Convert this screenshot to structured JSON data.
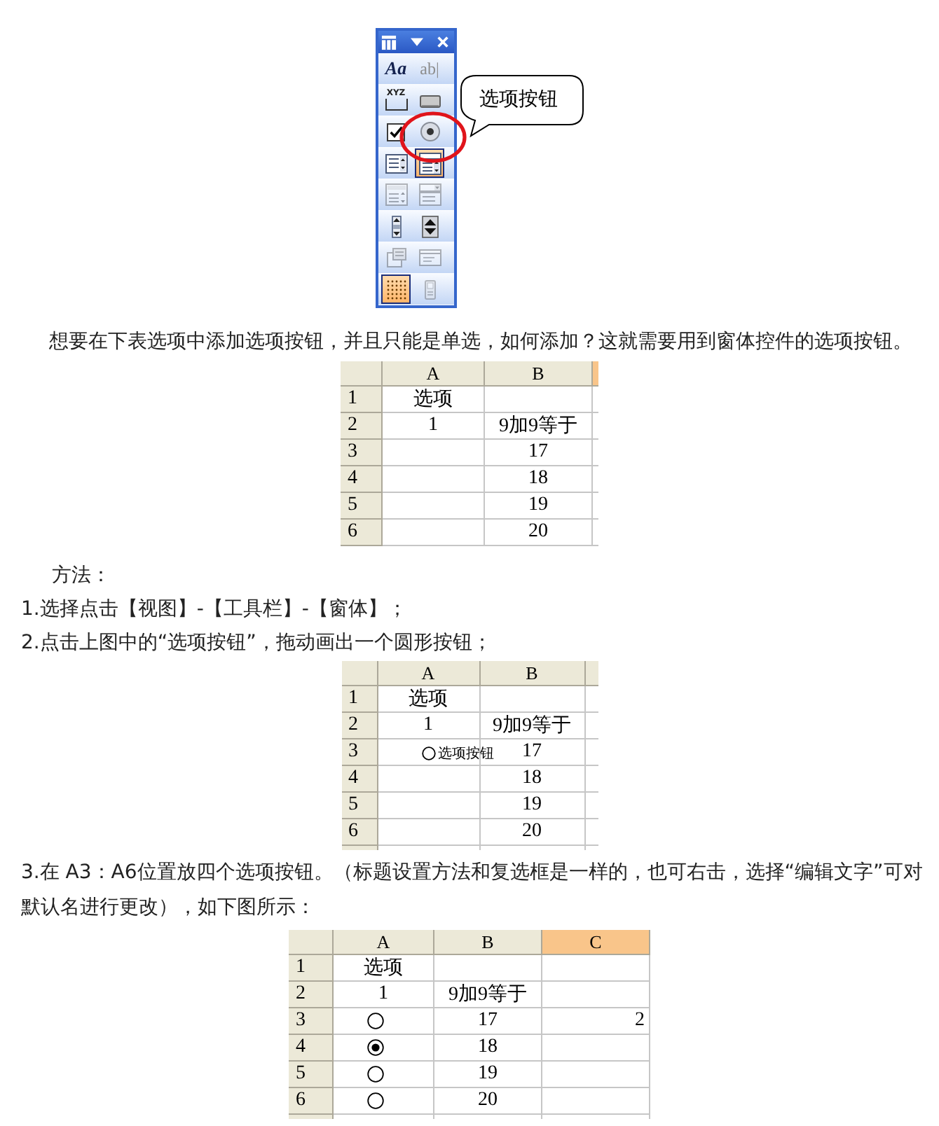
{
  "toolbar": {
    "buttons": [
      {
        "kind": "label",
        "text": "Aa",
        "selected": false,
        "disabled": false
      },
      {
        "kind": "edit_box",
        "text": "ab|",
        "selected": false,
        "disabled": true
      },
      {
        "kind": "group_box",
        "text": "XYZ",
        "selected": false,
        "disabled": false
      },
      {
        "kind": "button",
        "selected": false,
        "disabled": false
      },
      {
        "kind": "checkbox",
        "selected": false,
        "disabled": false
      },
      {
        "kind": "option_button",
        "selected": false,
        "disabled": false
      },
      {
        "kind": "list_box",
        "selected": false,
        "disabled": false
      },
      {
        "kind": "combo_box",
        "selected": true,
        "disabled": false
      },
      {
        "kind": "combo_list_edit",
        "selected": false,
        "disabled": true
      },
      {
        "kind": "combo_drop_edit",
        "selected": false,
        "disabled": true
      },
      {
        "kind": "scroll_bar",
        "selected": false,
        "disabled": false
      },
      {
        "kind": "spinner",
        "selected": false,
        "disabled": false
      },
      {
        "kind": "control_properties",
        "selected": false,
        "disabled": true
      },
      {
        "kind": "edit_code",
        "selected": false,
        "disabled": true
      },
      {
        "kind": "toggle_grid",
        "selected": true,
        "disabled": false
      },
      {
        "kind": "run_dialog",
        "selected": false,
        "disabled": true
      }
    ]
  },
  "callout": {
    "text": "选项按钮"
  },
  "intro": "想要在下表选项中添加选项按钮，并且只能是单选，如何添加？这就需要用到窗体控件的选项按钮。",
  "table_1": {
    "columns": [
      {
        "label": "A",
        "selected": false
      },
      {
        "label": "B",
        "selected": false
      }
    ],
    "cut_column": {
      "selected": true
    },
    "rows": [
      {
        "header": "1",
        "a": "选项"
      },
      {
        "header": "2",
        "a": "1",
        "b": "9加9等于"
      },
      {
        "header": "3",
        "b": "17"
      },
      {
        "header": "4",
        "b": "18"
      },
      {
        "header": "5",
        "b": "19"
      },
      {
        "header": "6",
        "b": "20"
      }
    ]
  },
  "method_heading": "方法：",
  "steps": [
    "1.选择点击【视图】-【工具栏】-【窗体】；",
    "2.点击上图中的“选项按钮”，拖动画出一个圆形按钮；"
  ],
  "table_2": {
    "columns": [
      {
        "label": "A",
        "selected": false
      },
      {
        "label": "B",
        "selected": false
      }
    ],
    "cut_column": {
      "selected": false
    },
    "cut_row": true,
    "rows": [
      {
        "header": "1",
        "a": "选项"
      },
      {
        "header": "2",
        "a": "1",
        "b": "9加9等于"
      },
      {
        "header": "3",
        "b": "17",
        "option_button": {
          "label": "选项按钮",
          "selected": false
        }
      },
      {
        "header": "4",
        "b": "18"
      },
      {
        "header": "5",
        "b": "19"
      },
      {
        "header": "6",
        "b": "20"
      }
    ]
  },
  "step_3": "3.在 A3：A6位置放四个选项按钮。（标题设置方法和复选框是一样的，也可右击，选择“编辑文字”可对默认名进行更改），如下图所示：",
  "table_3": {
    "columns": [
      {
        "label": "A",
        "selected": false
      },
      {
        "label": "B",
        "selected": false
      },
      {
        "label": "C",
        "selected": true
      }
    ],
    "cut_row": true,
    "rows": [
      {
        "header": "1",
        "a": "选项"
      },
      {
        "header": "2",
        "a": "1",
        "b": "9加9等于"
      },
      {
        "header": "3",
        "b": "17",
        "c": "2",
        "option_button": {
          "selected": false
        }
      },
      {
        "header": "4",
        "b": "18",
        "option_button": {
          "selected": true
        }
      },
      {
        "header": "5",
        "b": "19",
        "option_button": {
          "selected": false
        }
      },
      {
        "header": "6",
        "b": "20",
        "option_button": {
          "selected": false
        }
      }
    ]
  }
}
